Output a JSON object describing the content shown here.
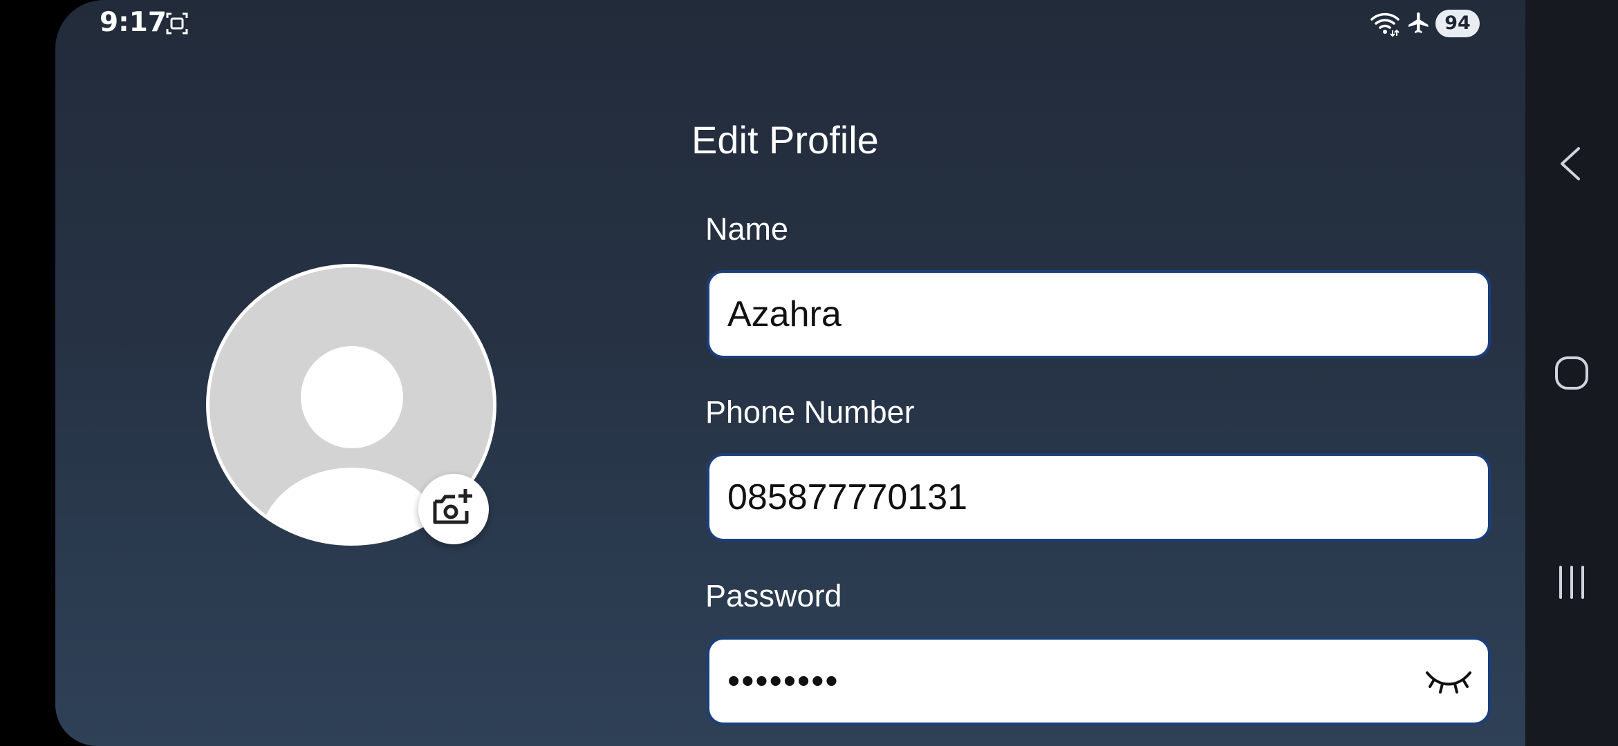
{
  "status_bar": {
    "time": "9:17",
    "battery": "94",
    "icons": [
      "screenshot-icon",
      "wifi-icon",
      "airplane-icon"
    ]
  },
  "page": {
    "title": "Edit Profile"
  },
  "form": {
    "name_label": "Name",
    "name_value": "Azahra",
    "phone_label": "Phone Number",
    "phone_value": "085877770131",
    "password_label": "Password",
    "password_value": "••••••••"
  },
  "avatar": {
    "placeholder_icon": "person-icon",
    "action_icon": "add-photo-icon"
  },
  "navigation": {
    "back_icon": "back-icon",
    "home_icon": "home-icon",
    "recents_icon": "recents-icon"
  },
  "colors": {
    "background_top": "#222b3a",
    "background_bottom": "#2f4157",
    "field_border": "#1b3f7a",
    "text": "#ffffff"
  }
}
